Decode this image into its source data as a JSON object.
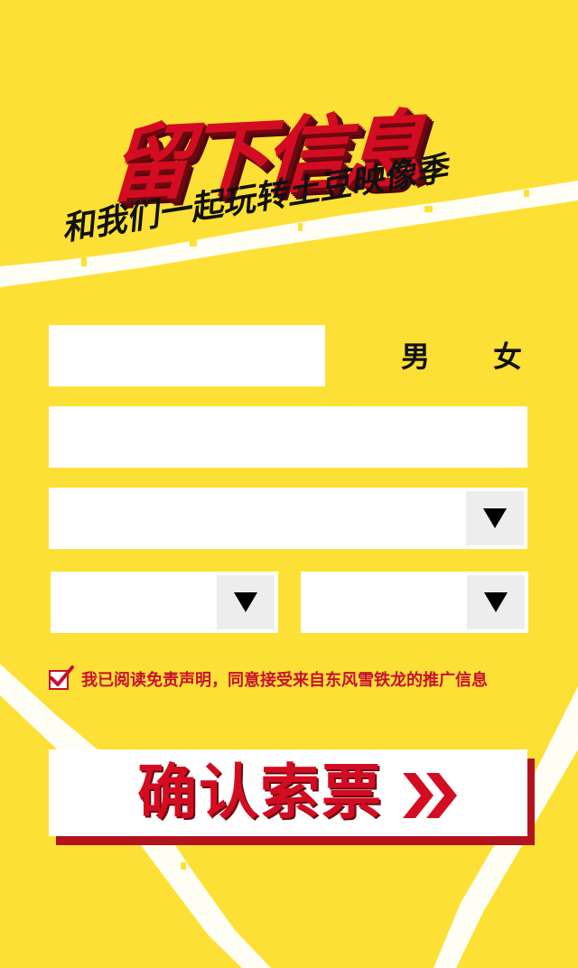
{
  "headline": {
    "title": "留下信息",
    "subtitle": "和我们一起玩转土豆映像季"
  },
  "form": {
    "name": {
      "value": "",
      "placeholder": ""
    },
    "gender_options": [
      "男",
      "女"
    ],
    "phone": {
      "value": "",
      "placeholder": ""
    },
    "model_select": {
      "value": ""
    },
    "province_select": {
      "value": ""
    },
    "city_select": {
      "value": ""
    },
    "agreement": {
      "checked": true,
      "text": "我已阅读免责声明，同意接受来自东风雪铁龙的推广信息"
    },
    "submit_label": "确认索票"
  },
  "colors": {
    "background": "#fde035",
    "brand_red": "#d40c22",
    "shadow_red": "#b3131d",
    "field_bg": "#ffffff"
  },
  "icons": [
    "dropdown-arrow-icon",
    "checkmark-icon",
    "double-chevron-icon"
  ]
}
